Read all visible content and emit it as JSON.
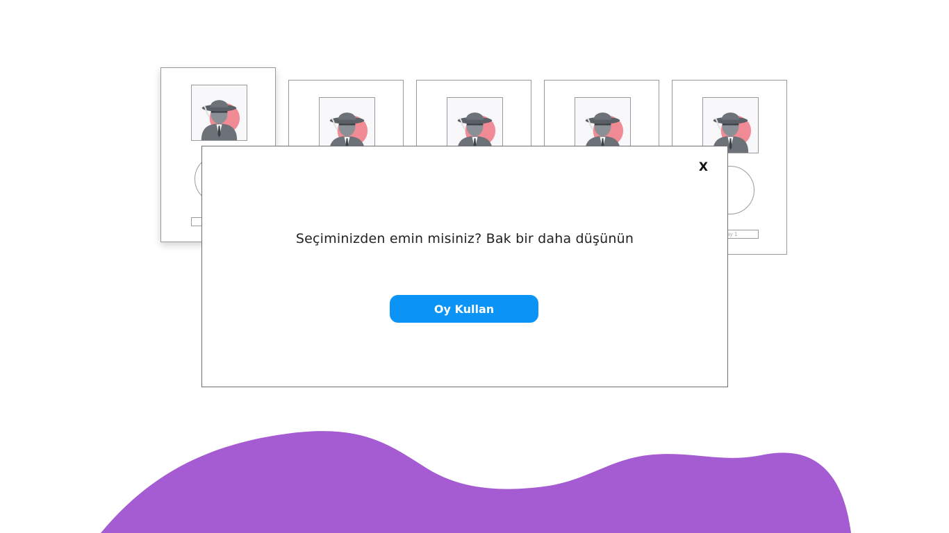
{
  "theme": {
    "blob_color": "#a55bd1",
    "button_color": "#0b93f6"
  },
  "candidates": [
    {
      "avatar_icon": "detective-avatar-icon",
      "name": "",
      "selected": true
    },
    {
      "avatar_icon": "detective-avatar-icon",
      "name": "",
      "selected": false
    },
    {
      "avatar_icon": "detective-avatar-icon",
      "name": "",
      "selected": false
    },
    {
      "avatar_icon": "detective-avatar-icon",
      "name": "",
      "selected": false
    },
    {
      "avatar_icon": "detective-avatar-icon",
      "name": "day 1",
      "selected": false
    }
  ],
  "modal": {
    "close_label": "X",
    "message": "Seçiminizden emin misiniz? Bak bir daha düşünün",
    "vote_button_label": "Oy Kullan"
  }
}
